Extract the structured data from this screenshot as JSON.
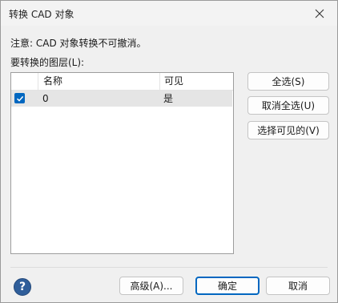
{
  "window": {
    "title": "转换 CAD 对象",
    "close_icon": "close-icon"
  },
  "note": "注意: CAD 对象转换不可撤消。",
  "layers_label": "要转换的图层(L):",
  "table": {
    "columns": [
      "名称",
      "可见"
    ],
    "rows": [
      {
        "checked": true,
        "name": "0",
        "visible": "是"
      }
    ]
  },
  "side_buttons": {
    "select_all": "全选(S)",
    "deselect_all": "取消全选(U)",
    "select_visible": "选择可见的(V)"
  },
  "footer": {
    "help_icon": "help-icon",
    "help_glyph": "?",
    "advanced": "高级(A)...",
    "ok": "确定",
    "cancel": "取消"
  },
  "colors": {
    "accent": "#0067c0",
    "help": "#2f5e9a",
    "row_selected": "#e5e5e5"
  }
}
